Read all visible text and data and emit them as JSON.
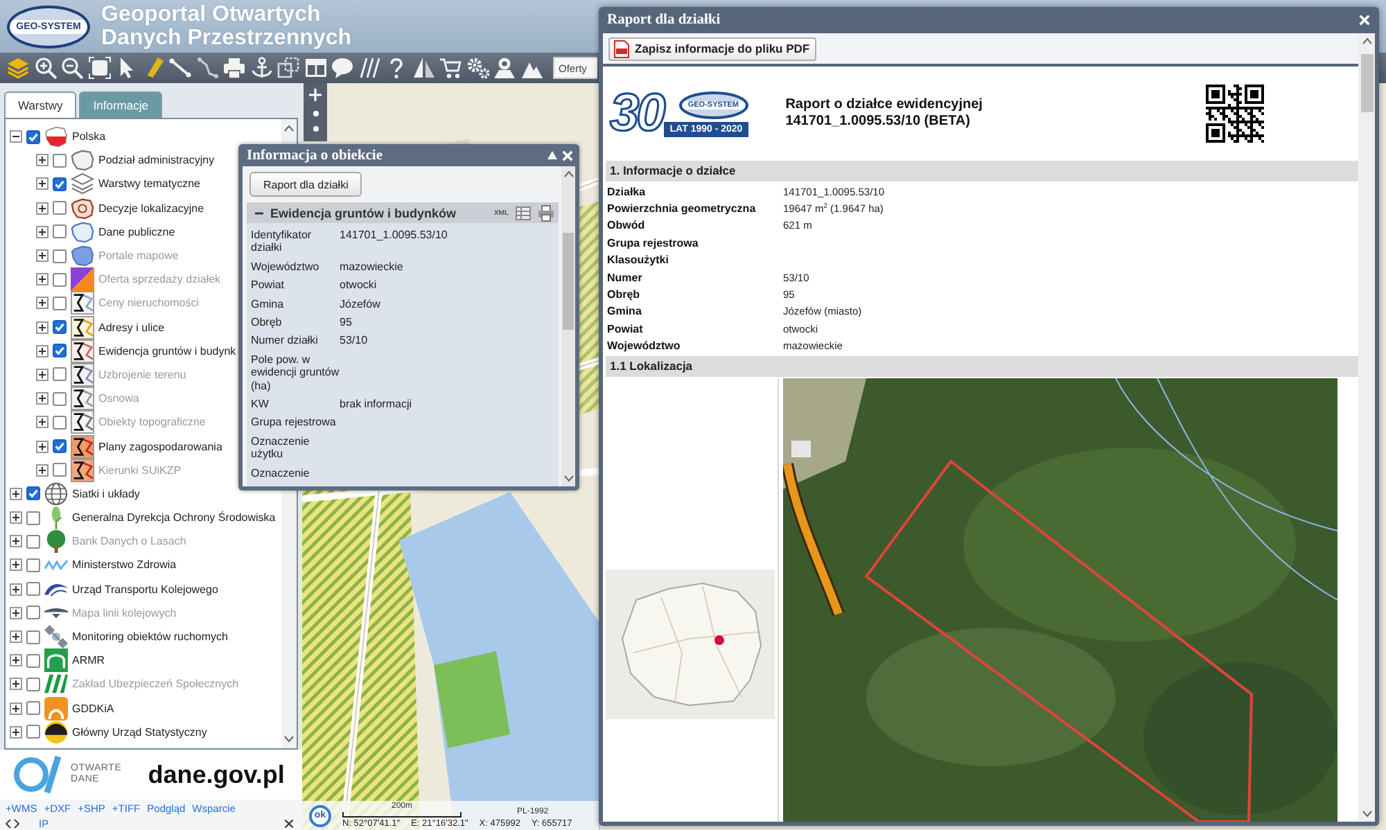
{
  "header": {
    "logo_text": "GEO-SYSTEM",
    "title_lines": [
      "Geoportal Otwartych",
      "Danych Przestrzennych"
    ]
  },
  "toolbar": {
    "offers_field": {
      "value": "Oferty"
    }
  },
  "left_panel": {
    "tabs": [
      {
        "label": "Warstwy",
        "selected": true
      },
      {
        "label": "Informacje",
        "selected": false
      }
    ],
    "layers": [
      {
        "label": "Polska",
        "checked": true,
        "expanded": true,
        "disabled": false,
        "children": [
          {
            "label": "Podział administracyjny",
            "checked": false,
            "expanded": false,
            "disabled": false
          },
          {
            "label": "Warstwy tematyczne",
            "checked": true,
            "expanded": false,
            "disabled": false
          },
          {
            "label": "Decyzje lokalizacyjne",
            "checked": false,
            "expanded": false,
            "disabled": false
          },
          {
            "label": "Dane publiczne",
            "checked": false,
            "expanded": false,
            "disabled": false
          },
          {
            "label": "Portale mapowe",
            "checked": false,
            "expanded": false,
            "disabled": true
          },
          {
            "label": "Oferta sprzedaży działek",
            "checked": false,
            "expanded": false,
            "disabled": true
          },
          {
            "label": "Ceny nieruchomości",
            "checked": false,
            "expanded": false,
            "disabled": true
          },
          {
            "label": "Adresy i ulice",
            "checked": true,
            "expanded": false,
            "disabled": false
          },
          {
            "label": "Ewidencja gruntów i budynk",
            "checked": true,
            "expanded": false,
            "disabled": false
          },
          {
            "label": "Uzbrojenie terenu",
            "checked": false,
            "expanded": false,
            "disabled": true
          },
          {
            "label": "Osnowa",
            "checked": false,
            "expanded": false,
            "disabled": true
          },
          {
            "label": "Obiekty topograficzne",
            "checked": false,
            "expanded": false,
            "disabled": true
          },
          {
            "label": "Plany zagospodarowania",
            "checked": true,
            "expanded": false,
            "disabled": false
          },
          {
            "label": "Kierunki SUiKZP",
            "checked": false,
            "expanded": false,
            "disabled": true
          }
        ]
      },
      {
        "label": "Siatki i układy",
        "checked": true,
        "expanded": false,
        "disabled": false
      },
      {
        "label": "Generalna Dyrekcja Ochrony Środowiska",
        "checked": false,
        "expanded": false,
        "disabled": false
      },
      {
        "label": "Bank Danych o Lasach",
        "checked": false,
        "expanded": false,
        "disabled": true
      },
      {
        "label": "Ministerstwo Zdrowia",
        "checked": false,
        "expanded": false,
        "disabled": false
      },
      {
        "label": "Urząd Transportu Kolejowego",
        "checked": false,
        "expanded": false,
        "disabled": false
      },
      {
        "label": "Mapa linii kolejowych",
        "checked": false,
        "expanded": false,
        "disabled": true
      },
      {
        "label": "Monitoring obiektów ruchomych",
        "checked": false,
        "expanded": false,
        "disabled": false
      },
      {
        "label": "ARMR",
        "checked": false,
        "expanded": false,
        "disabled": false
      },
      {
        "label": "Zakład Ubezpieczeń Społecznych",
        "checked": false,
        "expanded": false,
        "disabled": true
      },
      {
        "label": "GDDKiA",
        "checked": false,
        "expanded": false,
        "disabled": false
      },
      {
        "label": "Główny Urząd Statystyczny",
        "checked": false,
        "expanded": false,
        "disabled": false
      }
    ],
    "open_data_logo": {
      "line1": "OTWARTE",
      "line2": "DANE",
      "domain": "dane.gov.pl"
    },
    "links": [
      "+WMS",
      "+DXF",
      "+SHP",
      "+TIFF",
      "Podgląd",
      "Wsparcie"
    ],
    "footer_label": "IP"
  },
  "map": {
    "ok_button": "ok",
    "scale_label": "200m",
    "projection": "PL-1992",
    "coordinates": [
      "N: 52°07'41.1\"",
      "E: 21°16'32.1\"",
      "X: 475992",
      "Y: 655717"
    ]
  },
  "object_info": {
    "title": "Informacja o obiekcie",
    "report_button": "Raport dla działki",
    "section": {
      "title": "Ewidencja gruntów i budynków",
      "expanded": true,
      "xml_label": "XML"
    },
    "rows": [
      {
        "label": "Identyfikator działki",
        "value": "141701_1.0095.53/10"
      },
      {
        "label": "Województwo",
        "value": "mazowieckie"
      },
      {
        "label": "Powiat",
        "value": "otwocki"
      },
      {
        "label": "Gmina",
        "value": "Józefów"
      },
      {
        "label": "Obręb",
        "value": "95"
      },
      {
        "label": "Numer działki",
        "value": "53/10"
      },
      {
        "label": "Pole pow. w ewidencji gruntów (ha)"
      },
      {
        "label": "KW",
        "value": "brak informacji"
      },
      {
        "label": "Grupa rejestrowa"
      },
      {
        "label": "Oznaczenie użytku"
      },
      {
        "label": "Oznaczenie"
      }
    ]
  },
  "report": {
    "title": "Raport dla działki",
    "pdf_button": "Zapisz informacje do pliku PDF",
    "logo": {
      "number": "30",
      "brand": "GEO-SYSTEM",
      "banner": "LAT 1990 - 2020"
    },
    "heading": [
      "Raport o działce ewidencyjnej",
      "141701_1.0095.53/10 (BETA)"
    ],
    "sections": [
      {
        "kind": "table",
        "title": "1. Informacje o działce",
        "rows": [
          {
            "label": "Działka",
            "value": "141701_1.0095.53/10"
          },
          {
            "label": "Powierzchnia geometryczna",
            "value": "19647 m$^{2}$ (1.9647 ha)"
          },
          {
            "label": "Obwód",
            "value": "621 m"
          },
          {
            "label": "Grupa rejestrowa"
          },
          {
            "label": "Klasoużytki"
          },
          {
            "label": "Numer",
            "value": "53/10"
          },
          {
            "label": "Obręb",
            "value": "95"
          },
          {
            "label": "Gmina",
            "value": "Józefów (miasto)"
          },
          {
            "label": "Powiat",
            "value": "otwocki"
          },
          {
            "label": "Województwo",
            "value": "mazowieckie"
          }
        ]
      },
      {
        "kind": "maps",
        "title": "1.1 Lokalizacja"
      }
    ]
  }
}
